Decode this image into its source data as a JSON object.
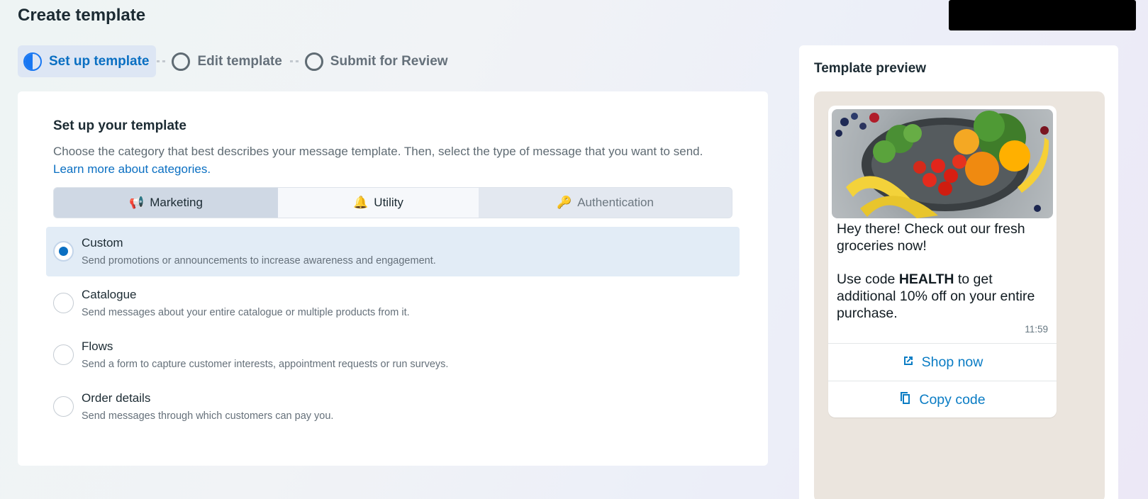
{
  "page": {
    "title": "Create template"
  },
  "stepper": {
    "steps": [
      {
        "label": "Set up template",
        "state": "active"
      },
      {
        "label": "Edit template",
        "state": "inactive"
      },
      {
        "label": "Submit for Review",
        "state": "inactive"
      }
    ]
  },
  "setup": {
    "title": "Set up your template",
    "description": "Choose the category that best describes your message template. Then, select the type of message that you want to send.",
    "learn_more": "Learn more about categories.",
    "categories": [
      {
        "label": "Marketing",
        "icon": "megaphone-icon"
      },
      {
        "label": "Utility",
        "icon": "bell-icon"
      },
      {
        "label": "Authentication",
        "icon": "key-icon"
      }
    ],
    "selected_category": "Marketing",
    "options": [
      {
        "title": "Custom",
        "desc": "Send promotions or announcements to increase awareness and engagement.",
        "selected": true
      },
      {
        "title": "Catalogue",
        "desc": "Send messages about your entire catalogue or multiple products from it.",
        "selected": false
      },
      {
        "title": "Flows",
        "desc": "Send a form to capture customer interests, appointment requests or run surveys.",
        "selected": false
      },
      {
        "title": "Order details",
        "desc": "Send messages through which customers can pay you.",
        "selected": false
      }
    ]
  },
  "preview": {
    "title": "Template preview",
    "message_line1": "Hey there! Check out our fresh groceries now!",
    "message_part2_prefix": "Use code ",
    "message_code": "HEALTH",
    "message_part2_suffix": " to get additional 10% off on your entire purchase.",
    "time": "11:59",
    "buttons": [
      {
        "label": "Shop now",
        "icon": "external-link-icon"
      },
      {
        "label": "Copy code",
        "icon": "copy-icon"
      }
    ]
  },
  "colors": {
    "accent": "#0a6fc2",
    "brand_blue": "#1877f2",
    "chat_bg": "#ebe5de"
  }
}
